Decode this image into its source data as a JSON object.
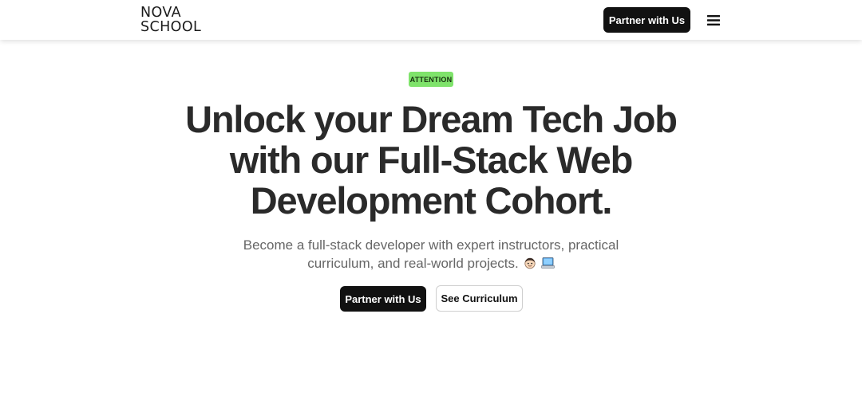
{
  "header": {
    "logo_line1": "NOVA",
    "logo_line2": "SCHOOL",
    "cta_label": "Partner with Us",
    "menu_icon": "hamburger-menu-icon"
  },
  "hero": {
    "badge": "ATTENTION",
    "badge_color": "#7fe36b",
    "headline_line1": "Unlock your Dream Tech Job",
    "headline_line2": "with our Full-Stack Web",
    "headline_line3": "Development Cohort.",
    "subtitle_line1": "Become a full-stack developer with expert instructors, practical",
    "subtitle_line2": "curriculum, and real-world projects.",
    "emoji_icons": [
      "technologist-face-icon",
      "laptop-icon"
    ],
    "primary_button": "Partner with Us",
    "secondary_button": "See Curriculum"
  },
  "colors": {
    "accent_dark": "#111111",
    "headline": "#2a2a2a",
    "subtitle": "#666666"
  }
}
